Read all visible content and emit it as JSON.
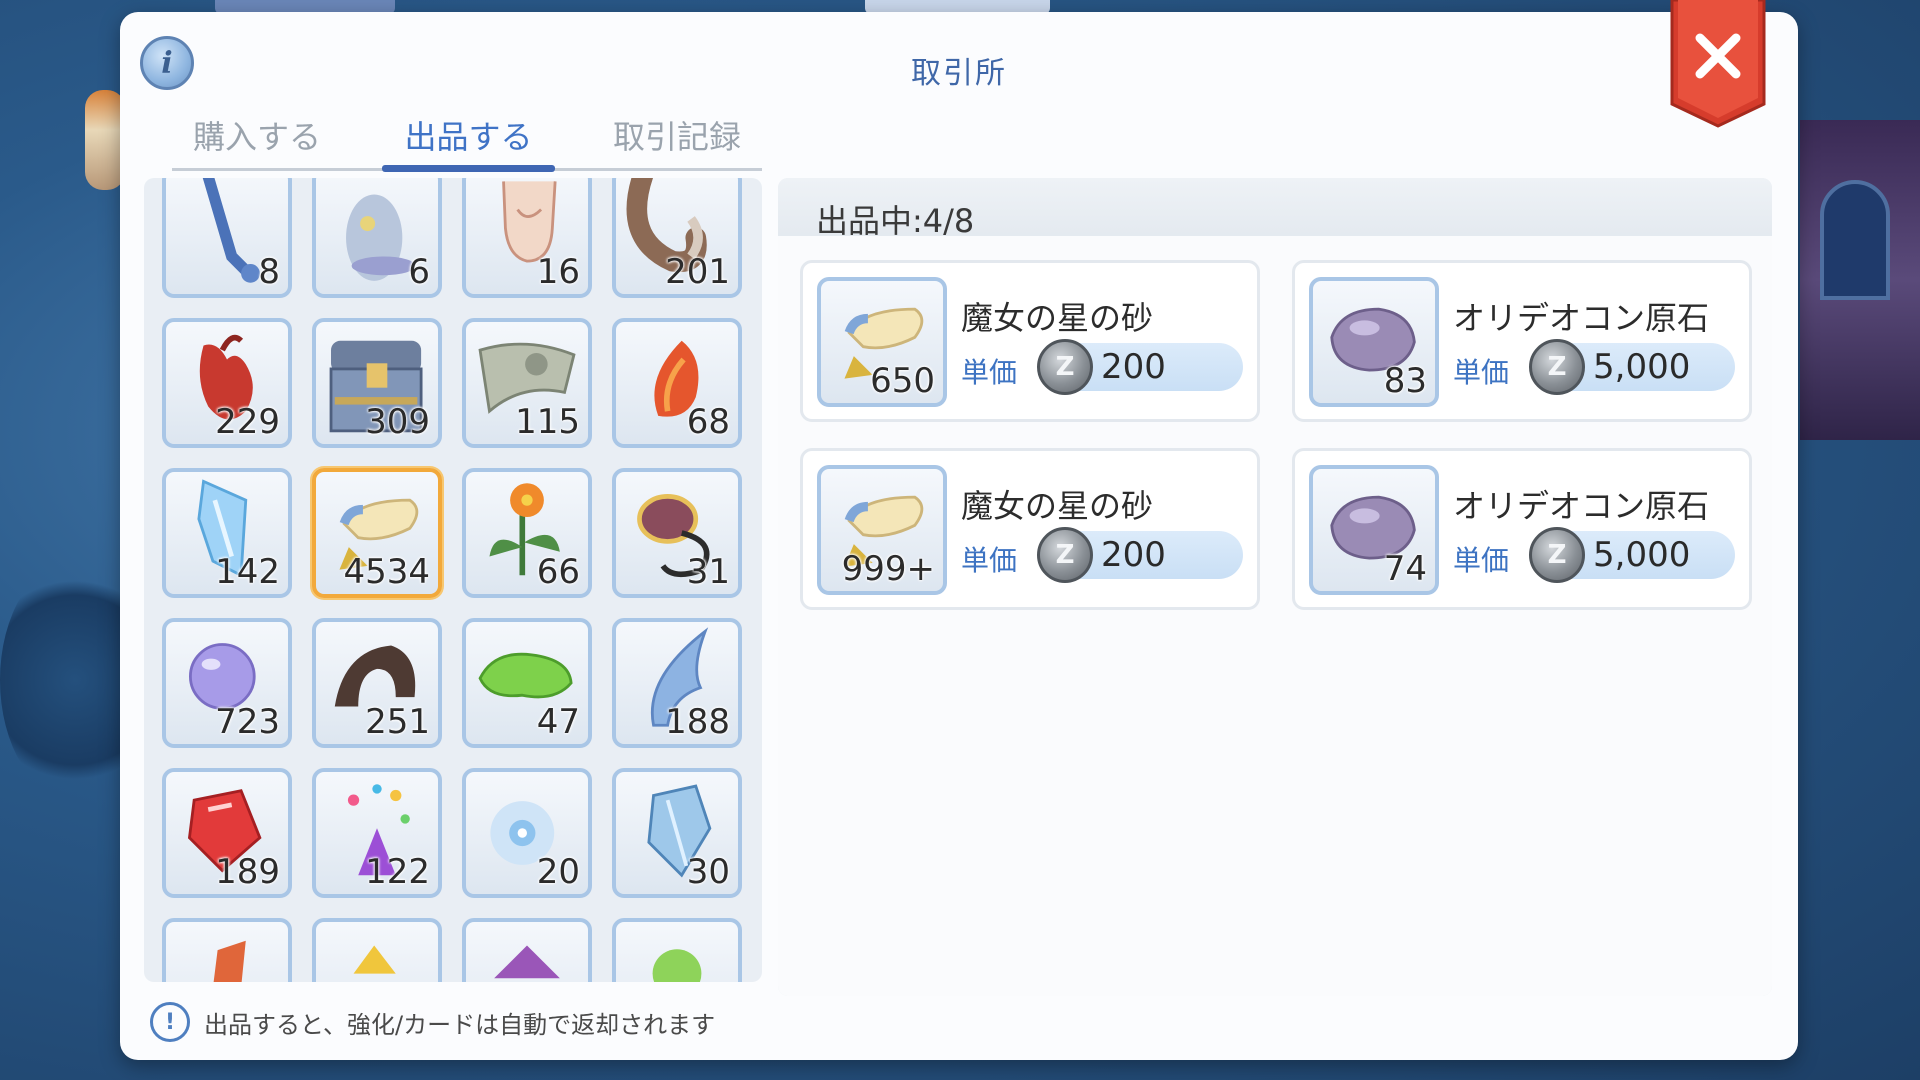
{
  "window": {
    "title": "取引所",
    "tabs": [
      {
        "label": "購入する",
        "active": false
      },
      {
        "label": "出品する",
        "active": true
      },
      {
        "label": "取引記録",
        "active": false
      }
    ]
  },
  "inventory": {
    "items": [
      {
        "icon": "blue-bone-icon",
        "qty": "8"
      },
      {
        "icon": "ghost-figure-icon",
        "qty": "6"
      },
      {
        "icon": "hand-icon",
        "qty": "16"
      },
      {
        "icon": "horn-icon",
        "qty": "201"
      },
      {
        "icon": "red-heart-icon",
        "qty": "229"
      },
      {
        "icon": "treasure-chest-icon",
        "qty": "309"
      },
      {
        "icon": "cloth-scrap-icon",
        "qty": "115"
      },
      {
        "icon": "flame-feather-icon",
        "qty": "68"
      },
      {
        "icon": "ice-crystal-icon",
        "qty": "142"
      },
      {
        "icon": "star-sand-icon",
        "qty": "4534",
        "selected": true
      },
      {
        "icon": "orange-flower-icon",
        "qty": "66"
      },
      {
        "icon": "shell-creature-icon",
        "qty": "31"
      },
      {
        "icon": "purple-orb-icon",
        "qty": "723"
      },
      {
        "icon": "dark-horn-icon",
        "qty": "251"
      },
      {
        "icon": "green-slime-icon",
        "qty": "47"
      },
      {
        "icon": "blue-wing-icon",
        "qty": "188"
      },
      {
        "icon": "red-gem-icon",
        "qty": "189"
      },
      {
        "icon": "party-popper-icon",
        "qty": "122"
      },
      {
        "icon": "blue-sparkle-icon",
        "qty": "20"
      },
      {
        "icon": "blue-crystal-icon",
        "qty": "30"
      },
      {
        "icon": "orange-shard-icon",
        "qty": ""
      },
      {
        "icon": "yellow-gem-icon",
        "qty": ""
      },
      {
        "icon": "purple-gem-icon",
        "qty": ""
      },
      {
        "icon": "green-orb-icon",
        "qty": ""
      }
    ]
  },
  "notice": {
    "icon": "exclamation-icon",
    "text": "出品すると、強化/カードは自動で返却されます"
  },
  "listings": {
    "count_label": "出品中:4/8",
    "unit_label": "単価",
    "zeny_symbol": "Z",
    "items": [
      {
        "name": "魔女の星の砂",
        "qty": "650",
        "price": "200",
        "icon": "star-sand-icon"
      },
      {
        "name": "オリデオコン原石",
        "qty": "83",
        "price": "5,000",
        "icon": "oridecon-ore-icon"
      },
      {
        "name": "魔女の星の砂",
        "qty": "999+",
        "price": "200",
        "icon": "star-sand-icon"
      },
      {
        "name": "オリデオコン原石",
        "qty": "74",
        "price": "5,000",
        "icon": "oridecon-ore-icon"
      }
    ]
  },
  "colors": {
    "accent": "#3f66b3",
    "tab_inactive": "#9aa3ad",
    "slot_border": "#a9c6e6",
    "slot_selected": "#f2a93b",
    "close_red": "#d63c2c"
  }
}
